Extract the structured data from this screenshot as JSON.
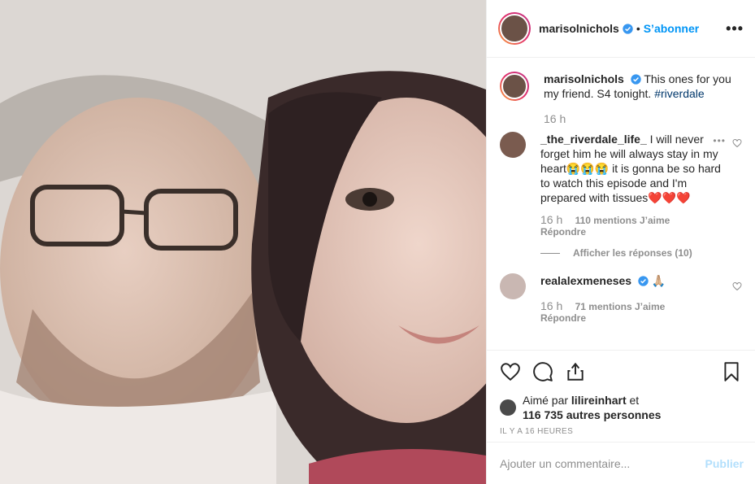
{
  "post": {
    "author": "marisolnichols",
    "follow_label": "S’abonner",
    "separator": "•",
    "more_label": "•••",
    "caption_text": "This ones for you my friend. S4 tonight. ",
    "caption_hashtag": "#riverdale",
    "caption_time": "16 h"
  },
  "comments": [
    {
      "username": "_the_riverdale_life_",
      "text": "I will never forget him he will always stay in my heart😭😭😭 it is gonna be so hard to watch this episode and I'm prepared with tissues❤️❤️❤️",
      "time": "16 h",
      "likes": "110 mentions J’aime",
      "reply_label": "Répondre",
      "more_label": "•••",
      "view_replies": "Afficher les réponses (10)"
    },
    {
      "username": "realalexmeneses",
      "text": "🙏🏼",
      "time": "16 h",
      "likes": "71 mentions J’aime",
      "reply_label": "Répondre"
    }
  ],
  "engagement": {
    "liked_by_prefix": "Aimé par",
    "liked_by_user": "lilireinhart",
    "liked_by_and": "et",
    "others": "116 735 autres personnes",
    "timestamp": "IL Y A 16 HEURES"
  },
  "composer": {
    "placeholder": "Ajouter un commentaire...",
    "post_label": "Publier"
  },
  "icons": [
    "heart-icon",
    "comment-icon",
    "share-icon",
    "bookmark-icon",
    "verified-badge-icon",
    "more-icon"
  ],
  "colors": {
    "link": "#0095f6",
    "hashtag": "#00376b",
    "muted": "#8e8e8e",
    "post_disabled": "#b2dffc"
  }
}
